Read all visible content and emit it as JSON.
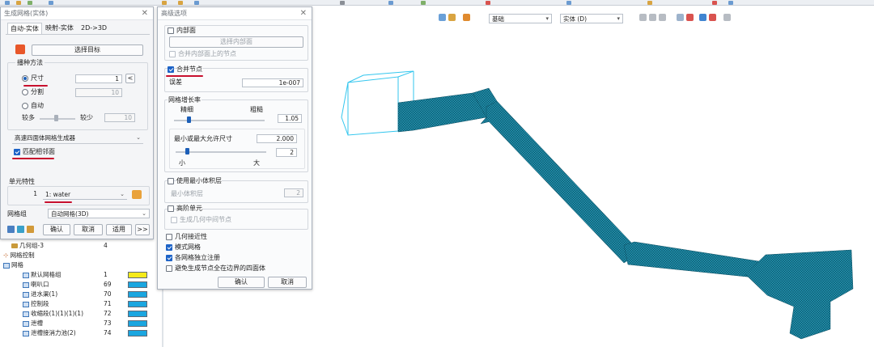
{
  "left_dialog": {
    "title": "生成网格(实体)",
    "tabs": [
      "自动-实体",
      "映射-实体",
      "2D->3D"
    ],
    "select_target_label": "选择目标",
    "seed_method": {
      "title": "播种方法",
      "size_label": "尺寸",
      "size_value": "1",
      "divide_label": "分割",
      "divide_value": "10",
      "auto_label": "自动",
      "more_label": "较多",
      "less_label": "较少",
      "auto_value": "10"
    },
    "generator_value": "高速四面体网格生成器",
    "match_adjacent_label": "匹配相邻面",
    "element_property": {
      "title": "单元特性",
      "id_value": "1",
      "material_value": "1: water"
    },
    "mesh_group": {
      "label": "网格组",
      "value": "自动网格(3D)"
    },
    "buttons": {
      "ok": "确认",
      "cancel": "取消",
      "apply": "适用",
      "more": ">>"
    }
  },
  "adv_dialog": {
    "title": "高级选项",
    "inner_face_label": "内部面",
    "select_inner_face_label": "选择内部面",
    "merge_inner_nodes_label": "合并内部面上的节点",
    "merge_nodes_label": "合并节点",
    "tolerance_label": "误差",
    "tolerance_value": "1e-007",
    "growth": {
      "title": "网格增长率",
      "fine_label": "精细",
      "coarse_label": "粗糙",
      "growth_value": "1.05",
      "min_max_label": "最小或最大允许尺寸",
      "min_max_value": "2.000",
      "ratio_value": "2",
      "small_label": "小",
      "large_label": "大"
    },
    "min_volume_label": "使用最小体积层",
    "min_volume_field_label": "最小体积层",
    "min_volume_value": "2",
    "high_order_label": "高阶单元",
    "gen_mid_nodes_label": "生成几何中间节点",
    "geom_approx_label": "几何接近性",
    "mode_mesh_label": "模式网格",
    "register_each_label": "各网格独立注册",
    "avoid_tetra_label": "避免生成节点全在边界的四面体",
    "ok": "确认",
    "cancel": "取消"
  },
  "toolbar": {
    "combo1_value": "基础",
    "combo2_value": "实体 (D)"
  },
  "tree": {
    "rows": [
      {
        "label": "几何组-3",
        "count": "4",
        "color": "",
        "icon": "folder-icon"
      },
      {
        "label": "网格控制",
        "count": "",
        "color": "",
        "icon": "mesh-control-icon"
      },
      {
        "label": "网格",
        "count": "",
        "color": "",
        "icon": "mesh-icon"
      },
      {
        "label": "默认网格组",
        "count": "1",
        "color": "#f5ea1a",
        "icon": "mesh-icon"
      },
      {
        "label": "喇叭口",
        "count": "69",
        "color": "#1aa6e0",
        "icon": "mesh-icon"
      },
      {
        "label": "进水渠(1)",
        "count": "70",
        "color": "#1aa6e0",
        "icon": "mesh-icon"
      },
      {
        "label": "控制段",
        "count": "71",
        "color": "#1aa6e0",
        "icon": "mesh-icon"
      },
      {
        "label": "收缩段(1)(1)(1)(1)",
        "count": "72",
        "color": "#1aa6e0",
        "icon": "mesh-icon"
      },
      {
        "label": "泄槽",
        "count": "73",
        "color": "#1aa6e0",
        "icon": "mesh-icon"
      },
      {
        "label": "泄槽接消力池(2)",
        "count": "74",
        "color": "#1aa6e0",
        "icon": "mesh-icon"
      }
    ]
  },
  "colors": {
    "mesh": "#1e8aa8",
    "wireframe": "#33c6ee",
    "accent": "#1d63c7",
    "underline": "#c8102e"
  }
}
